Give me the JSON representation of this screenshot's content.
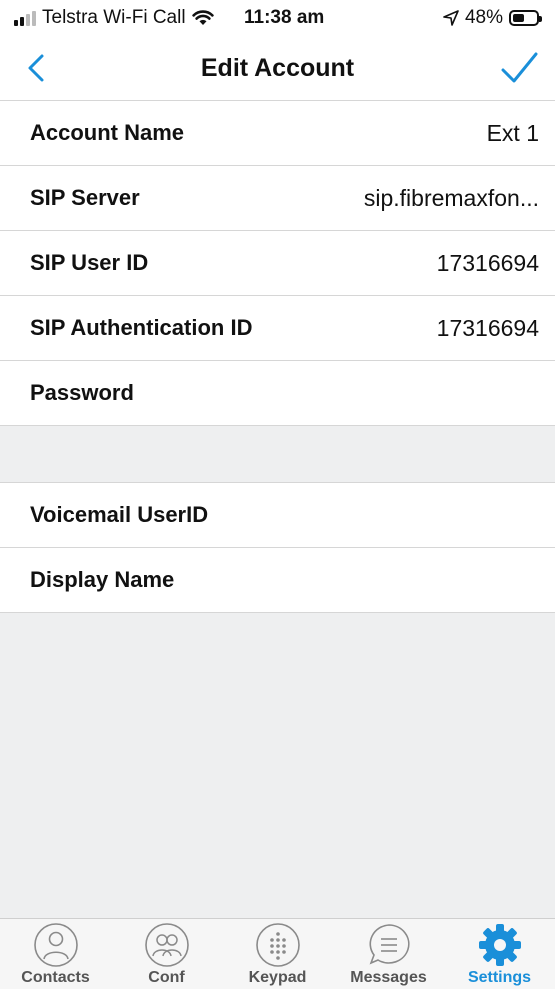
{
  "status_bar": {
    "carrier": "Telstra Wi-Fi Call",
    "time": "11:38 am",
    "battery": "48%",
    "battery_level": 0.48
  },
  "nav": {
    "title": "Edit Account",
    "back_icon": "chevron-left-icon",
    "done_icon": "checkmark-icon",
    "accent_color": "#1a8fd9"
  },
  "fields": [
    {
      "label": "Account Name",
      "value": "Ext 1"
    },
    {
      "label": "SIP Server",
      "value": "sip.fibremaxfon..."
    },
    {
      "label": "SIP User ID",
      "value": "17316694"
    },
    {
      "label": "SIP Authentication ID",
      "value": "17316694"
    },
    {
      "label": "Password",
      "value": ""
    }
  ],
  "fields2": [
    {
      "label": "Voicemail UserID",
      "value": ""
    },
    {
      "label": "Display Name",
      "value": ""
    }
  ],
  "tabs": [
    {
      "label": "Contacts",
      "icon": "person-icon"
    },
    {
      "label": "Conf",
      "icon": "group-icon"
    },
    {
      "label": "Keypad",
      "icon": "keypad-icon"
    },
    {
      "label": "Messages",
      "icon": "message-icon"
    },
    {
      "label": "Settings",
      "icon": "gear-icon",
      "active": true
    }
  ]
}
